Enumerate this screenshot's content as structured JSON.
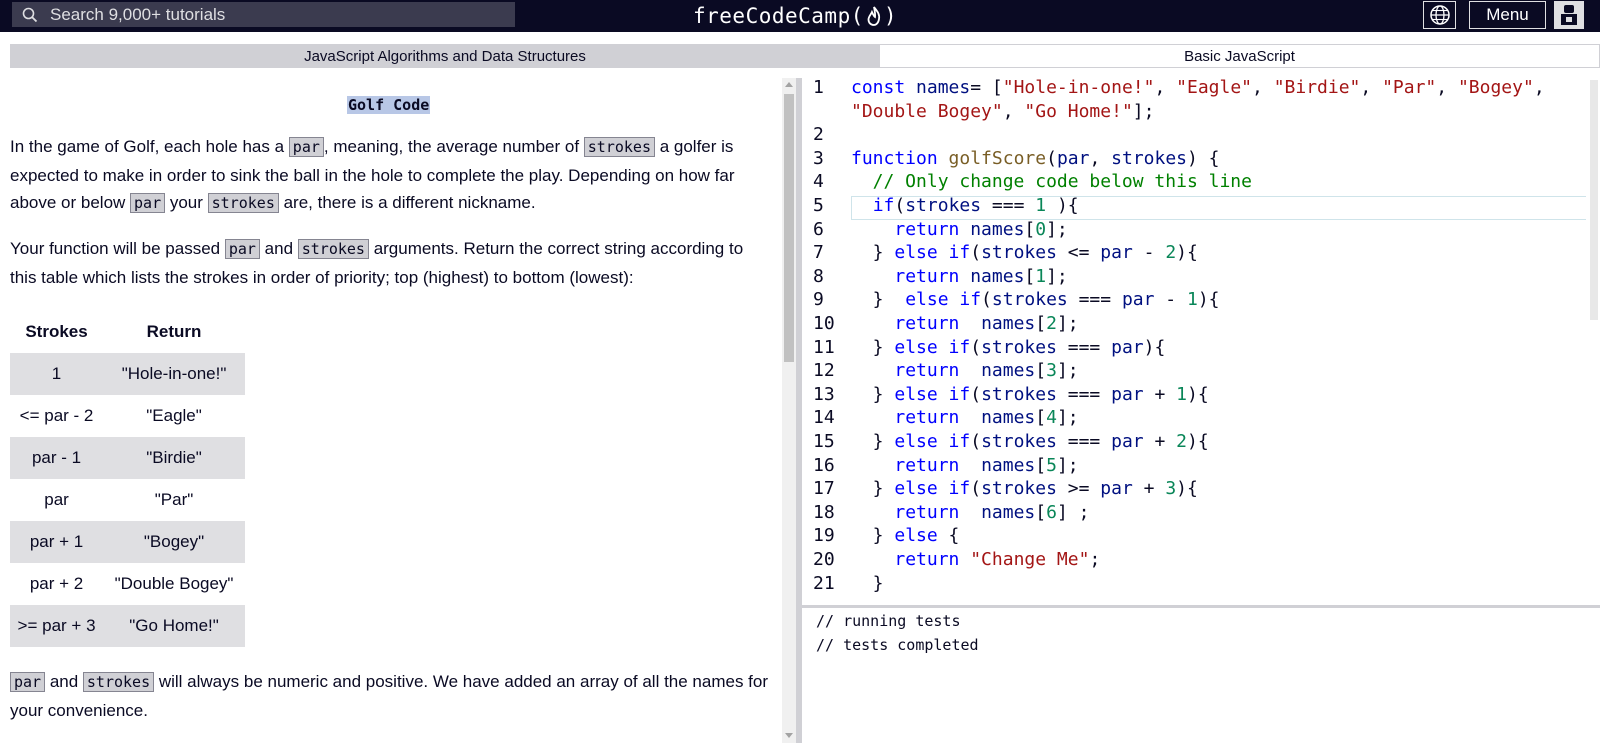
{
  "navbar": {
    "search_placeholder": "Search 9,000+ tutorials",
    "brand_left": "freeCodeCamp(",
    "brand_right": ")",
    "menu_label": "Menu"
  },
  "breadcrumb": {
    "superblock": "JavaScript Algorithms and Data Structures",
    "block": "Basic JavaScript"
  },
  "instructions": {
    "title": "Golf Code",
    "p1": [
      {
        "t": "In the game of Golf, each hole has a "
      },
      {
        "c": "par"
      },
      {
        "t": ", meaning, the average number of "
      },
      {
        "c": "strokes"
      },
      {
        "t": " a golfer is expected to make in order to sink the ball in the hole to complete the play. Depending on how far above or below "
      },
      {
        "c": "par"
      },
      {
        "t": " your "
      },
      {
        "c": "strokes"
      },
      {
        "t": " are, there is a different nickname."
      }
    ],
    "p2": [
      {
        "t": "Your function will be passed "
      },
      {
        "c": "par"
      },
      {
        "t": " and "
      },
      {
        "c": "strokes"
      },
      {
        "t": " arguments. Return the correct string according to this table which lists the strokes in order of priority; top (highest) to bottom (lowest):"
      }
    ],
    "table": {
      "headers": [
        "Strokes",
        "Return"
      ],
      "rows": [
        [
          "1",
          "\"Hole-in-one!\""
        ],
        [
          "<= par - 2",
          "\"Eagle\""
        ],
        [
          "par - 1",
          "\"Birdie\""
        ],
        [
          "par",
          "\"Par\""
        ],
        [
          "par + 1",
          "\"Bogey\""
        ],
        [
          "par + 2",
          "\"Double Bogey\""
        ],
        [
          ">= par + 3",
          "\"Go Home!\""
        ]
      ]
    },
    "p3": [
      {
        "c": "par"
      },
      {
        "t": " and "
      },
      {
        "c": "strokes"
      },
      {
        "t": " will always be numeric and positive. We have added an array of all the names for your convenience."
      }
    ]
  },
  "editor": {
    "lines": [
      {
        "n": "1",
        "tokens": [
          [
            "kw",
            "const "
          ],
          [
            "idn",
            "names"
          ],
          [
            "",
            "= ["
          ],
          [
            "str",
            "\"Hole-in-one!\""
          ],
          [
            "",
            ", "
          ],
          [
            "str",
            "\"Eagle\""
          ],
          [
            "",
            ", "
          ],
          [
            "str",
            "\"Birdie\""
          ],
          [
            "",
            ", "
          ],
          [
            "str",
            "\"Par\""
          ],
          [
            "",
            ", "
          ],
          [
            "str",
            "\"Bogey\""
          ],
          [
            "",
            ","
          ]
        ]
      },
      {
        "n": "",
        "tokens": [
          [
            "str",
            "\"Double Bogey\""
          ],
          [
            "",
            ", "
          ],
          [
            "str",
            "\"Go Home!\""
          ],
          [
            "",
            "];"
          ]
        ]
      },
      {
        "n": "2",
        "tokens": []
      },
      {
        "n": "3",
        "tokens": [
          [
            "kw",
            "function "
          ],
          [
            "fn",
            "golfScore"
          ],
          [
            "",
            "("
          ],
          [
            "idn",
            "par"
          ],
          [
            "",
            ", "
          ],
          [
            "idn",
            "strokes"
          ],
          [
            "",
            ") {"
          ]
        ]
      },
      {
        "n": "4",
        "tokens": [
          [
            "cm",
            "  // Only change code below this line"
          ]
        ]
      },
      {
        "n": "5",
        "tokens": [
          [
            "",
            "  "
          ],
          [
            "kw",
            "if"
          ],
          [
            "",
            "("
          ],
          [
            "idn",
            "strokes"
          ],
          [
            "",
            " === "
          ],
          [
            "num",
            "1"
          ],
          [
            "",
            " ){"
          ]
        ]
      },
      {
        "n": "6",
        "tokens": [
          [
            "",
            "    "
          ],
          [
            "kw",
            "return "
          ],
          [
            "idn",
            "names"
          ],
          [
            "",
            "["
          ],
          [
            "num",
            "0"
          ],
          [
            "",
            "];"
          ]
        ]
      },
      {
        "n": "7",
        "tokens": [
          [
            "",
            "  } "
          ],
          [
            "kw",
            "else if"
          ],
          [
            "",
            "("
          ],
          [
            "idn",
            "strokes"
          ],
          [
            "",
            " <= "
          ],
          [
            "idn",
            "par"
          ],
          [
            "",
            " - "
          ],
          [
            "num",
            "2"
          ],
          [
            "",
            "){"
          ]
        ]
      },
      {
        "n": "8",
        "tokens": [
          [
            "",
            "    "
          ],
          [
            "kw",
            "return "
          ],
          [
            "idn",
            "names"
          ],
          [
            "",
            "["
          ],
          [
            "num",
            "1"
          ],
          [
            "",
            "];"
          ]
        ]
      },
      {
        "n": "9",
        "tokens": [
          [
            "",
            "  }  "
          ],
          [
            "kw",
            "else if"
          ],
          [
            "",
            "("
          ],
          [
            "idn",
            "strokes"
          ],
          [
            "",
            " === "
          ],
          [
            "idn",
            "par"
          ],
          [
            "",
            " - "
          ],
          [
            "num",
            "1"
          ],
          [
            "",
            "){"
          ]
        ]
      },
      {
        "n": "10",
        "tokens": [
          [
            "",
            "    "
          ],
          [
            "kw",
            "return  "
          ],
          [
            "idn",
            "names"
          ],
          [
            "",
            "["
          ],
          [
            "num",
            "2"
          ],
          [
            "",
            "];"
          ]
        ]
      },
      {
        "n": "11",
        "tokens": [
          [
            "",
            "  } "
          ],
          [
            "kw",
            "else if"
          ],
          [
            "",
            "("
          ],
          [
            "idn",
            "strokes"
          ],
          [
            "",
            " === "
          ],
          [
            "idn",
            "par"
          ],
          [
            "",
            "){"
          ]
        ]
      },
      {
        "n": "12",
        "tokens": [
          [
            "",
            "    "
          ],
          [
            "kw",
            "return  "
          ],
          [
            "idn",
            "names"
          ],
          [
            "",
            "["
          ],
          [
            "num",
            "3"
          ],
          [
            "",
            "];"
          ]
        ]
      },
      {
        "n": "13",
        "tokens": [
          [
            "",
            "  } "
          ],
          [
            "kw",
            "else if"
          ],
          [
            "",
            "("
          ],
          [
            "idn",
            "strokes"
          ],
          [
            "",
            " === "
          ],
          [
            "idn",
            "par"
          ],
          [
            "",
            " + "
          ],
          [
            "num",
            "1"
          ],
          [
            "",
            "){"
          ]
        ]
      },
      {
        "n": "14",
        "tokens": [
          [
            "",
            "    "
          ],
          [
            "kw",
            "return  "
          ],
          [
            "idn",
            "names"
          ],
          [
            "",
            "["
          ],
          [
            "num",
            "4"
          ],
          [
            "",
            "];"
          ]
        ]
      },
      {
        "n": "15",
        "tokens": [
          [
            "",
            "  } "
          ],
          [
            "kw",
            "else if"
          ],
          [
            "",
            "("
          ],
          [
            "idn",
            "strokes"
          ],
          [
            "",
            " === "
          ],
          [
            "idn",
            "par"
          ],
          [
            "",
            " + "
          ],
          [
            "num",
            "2"
          ],
          [
            "",
            "){"
          ]
        ]
      },
      {
        "n": "16",
        "tokens": [
          [
            "",
            "    "
          ],
          [
            "kw",
            "return  "
          ],
          [
            "idn",
            "names"
          ],
          [
            "",
            "["
          ],
          [
            "num",
            "5"
          ],
          [
            "",
            "];"
          ]
        ]
      },
      {
        "n": "17",
        "tokens": [
          [
            "",
            "  } "
          ],
          [
            "kw",
            "else if"
          ],
          [
            "",
            "("
          ],
          [
            "idn",
            "strokes"
          ],
          [
            "",
            " >= "
          ],
          [
            "idn",
            "par"
          ],
          [
            "",
            " + "
          ],
          [
            "num",
            "3"
          ],
          [
            "",
            "){"
          ]
        ]
      },
      {
        "n": "18",
        "tokens": [
          [
            "",
            "    "
          ],
          [
            "kw",
            "return  "
          ],
          [
            "idn",
            "names"
          ],
          [
            "",
            "["
          ],
          [
            "num",
            "6"
          ],
          [
            "",
            "] ;"
          ]
        ]
      },
      {
        "n": "19",
        "tokens": [
          [
            "",
            "  } "
          ],
          [
            "kw",
            "else"
          ],
          [
            "",
            " {"
          ]
        ]
      },
      {
        "n": "20",
        "tokens": [
          [
            "",
            "    "
          ],
          [
            "kw",
            "return "
          ],
          [
            "str",
            "\"Change Me\""
          ],
          [
            "",
            ";"
          ]
        ]
      },
      {
        "n": "21",
        "tokens": [
          [
            "",
            "  }"
          ]
        ]
      }
    ]
  },
  "console": {
    "lines": [
      "// running tests",
      "// tests completed"
    ]
  },
  "colors": {
    "nav_bg": "#0a0a23",
    "search_bg": "#3b3b4f",
    "crumb_bg": "#d0d0d5",
    "keyword": "#0000ff",
    "string": "#a31515",
    "number": "#098658",
    "comment": "#008000"
  }
}
